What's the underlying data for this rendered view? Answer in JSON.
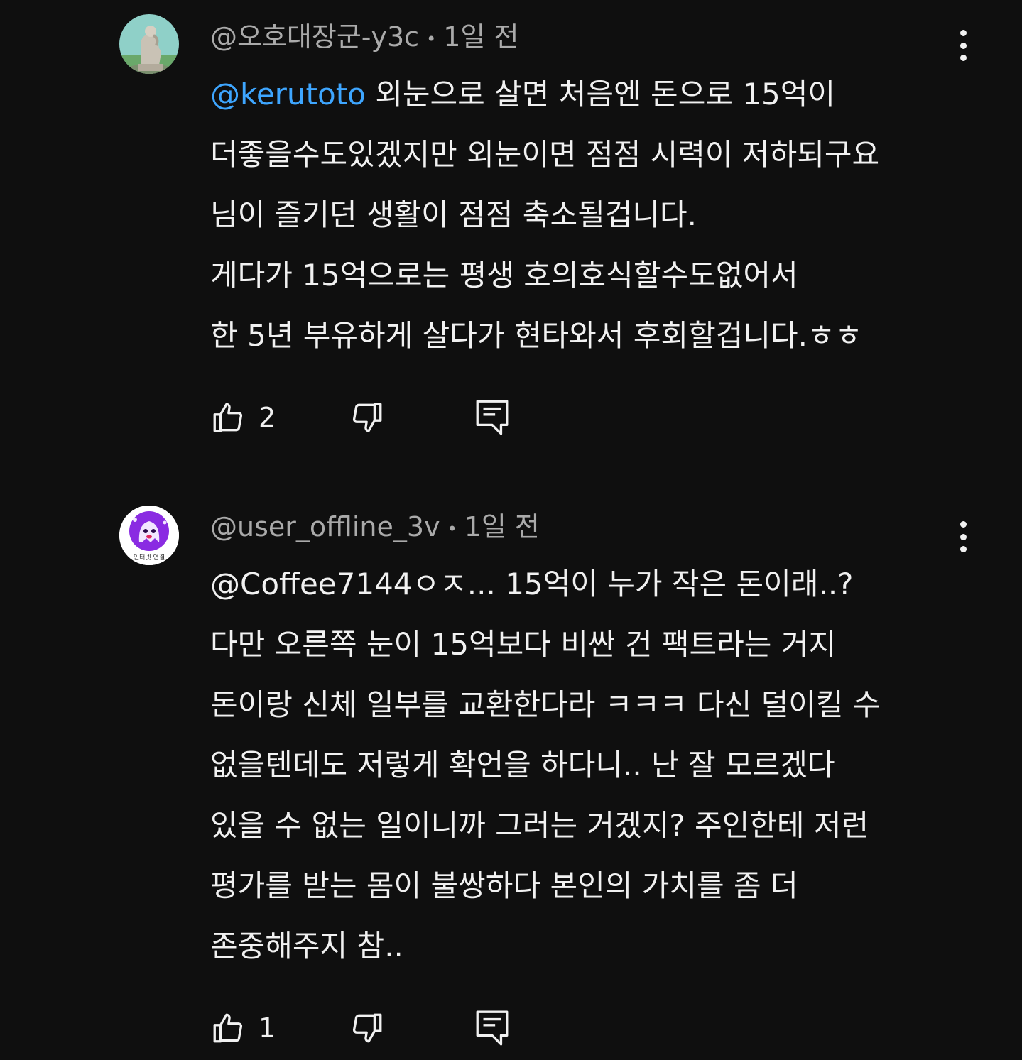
{
  "comments": [
    {
      "author": "@오호대장군-y3c",
      "age": "1일 전",
      "mention": "@kerutoto",
      "lines": [
        " 외눈으로 살면 처음엔 돈으로 15억이",
        "더좋을수도있겠지만 외눈이면 점점 시력이 저하되구요",
        "님이 즐기던 생활이 점점 축소될겁니다.",
        "게다가 15억으로는 평생 호의호식할수도없어서",
        "한 5년 부유하게 살다가 현타와서 후회할겁니다.ㅎㅎ"
      ],
      "likes": "2",
      "avatar_colors": {
        "sky": "#8fd0c8",
        "ground": "#6aa86a",
        "statue": "#c9c2b5"
      }
    },
    {
      "author": "@user_offline_3v",
      "age": "1일 전",
      "mention": "",
      "lines": [
        "@Coffee7144ㅇㅈ... 15억이 누가 작은 돈이래..?",
        "다만 오른쪽 눈이 15억보다 비싼 건 팩트라는 거지",
        "돈이랑 신체 일부를 교환한다라 ㅋㅋㅋ 다신 덜이킬 수",
        "없을텐데도 저렇게 확언을 하다니.. 난 잘 모르겠다",
        "있을 수 없는 일이니까 그러는 거겠지? 주인한테 저런",
        "평가를 받는 몸이 불쌍하다 본인의 가치를 좀 더",
        "존중해주지 참.."
      ],
      "likes": "1",
      "avatar_label": "인터넷 연결",
      "avatar_colors": {
        "bg": "#ffffff",
        "circle": "#8a2be2",
        "ghost": "#f2e6ff"
      }
    }
  ],
  "icons": {
    "like": "thumb-up-icon",
    "dislike": "thumb-down-icon",
    "reply": "reply-comment-icon",
    "menu": "more-vert-icon"
  },
  "colors": {
    "background": "#0f0f0f",
    "text": "#f1f1f1",
    "meta": "#aaaaaa",
    "mention": "#3ea6ff"
  }
}
